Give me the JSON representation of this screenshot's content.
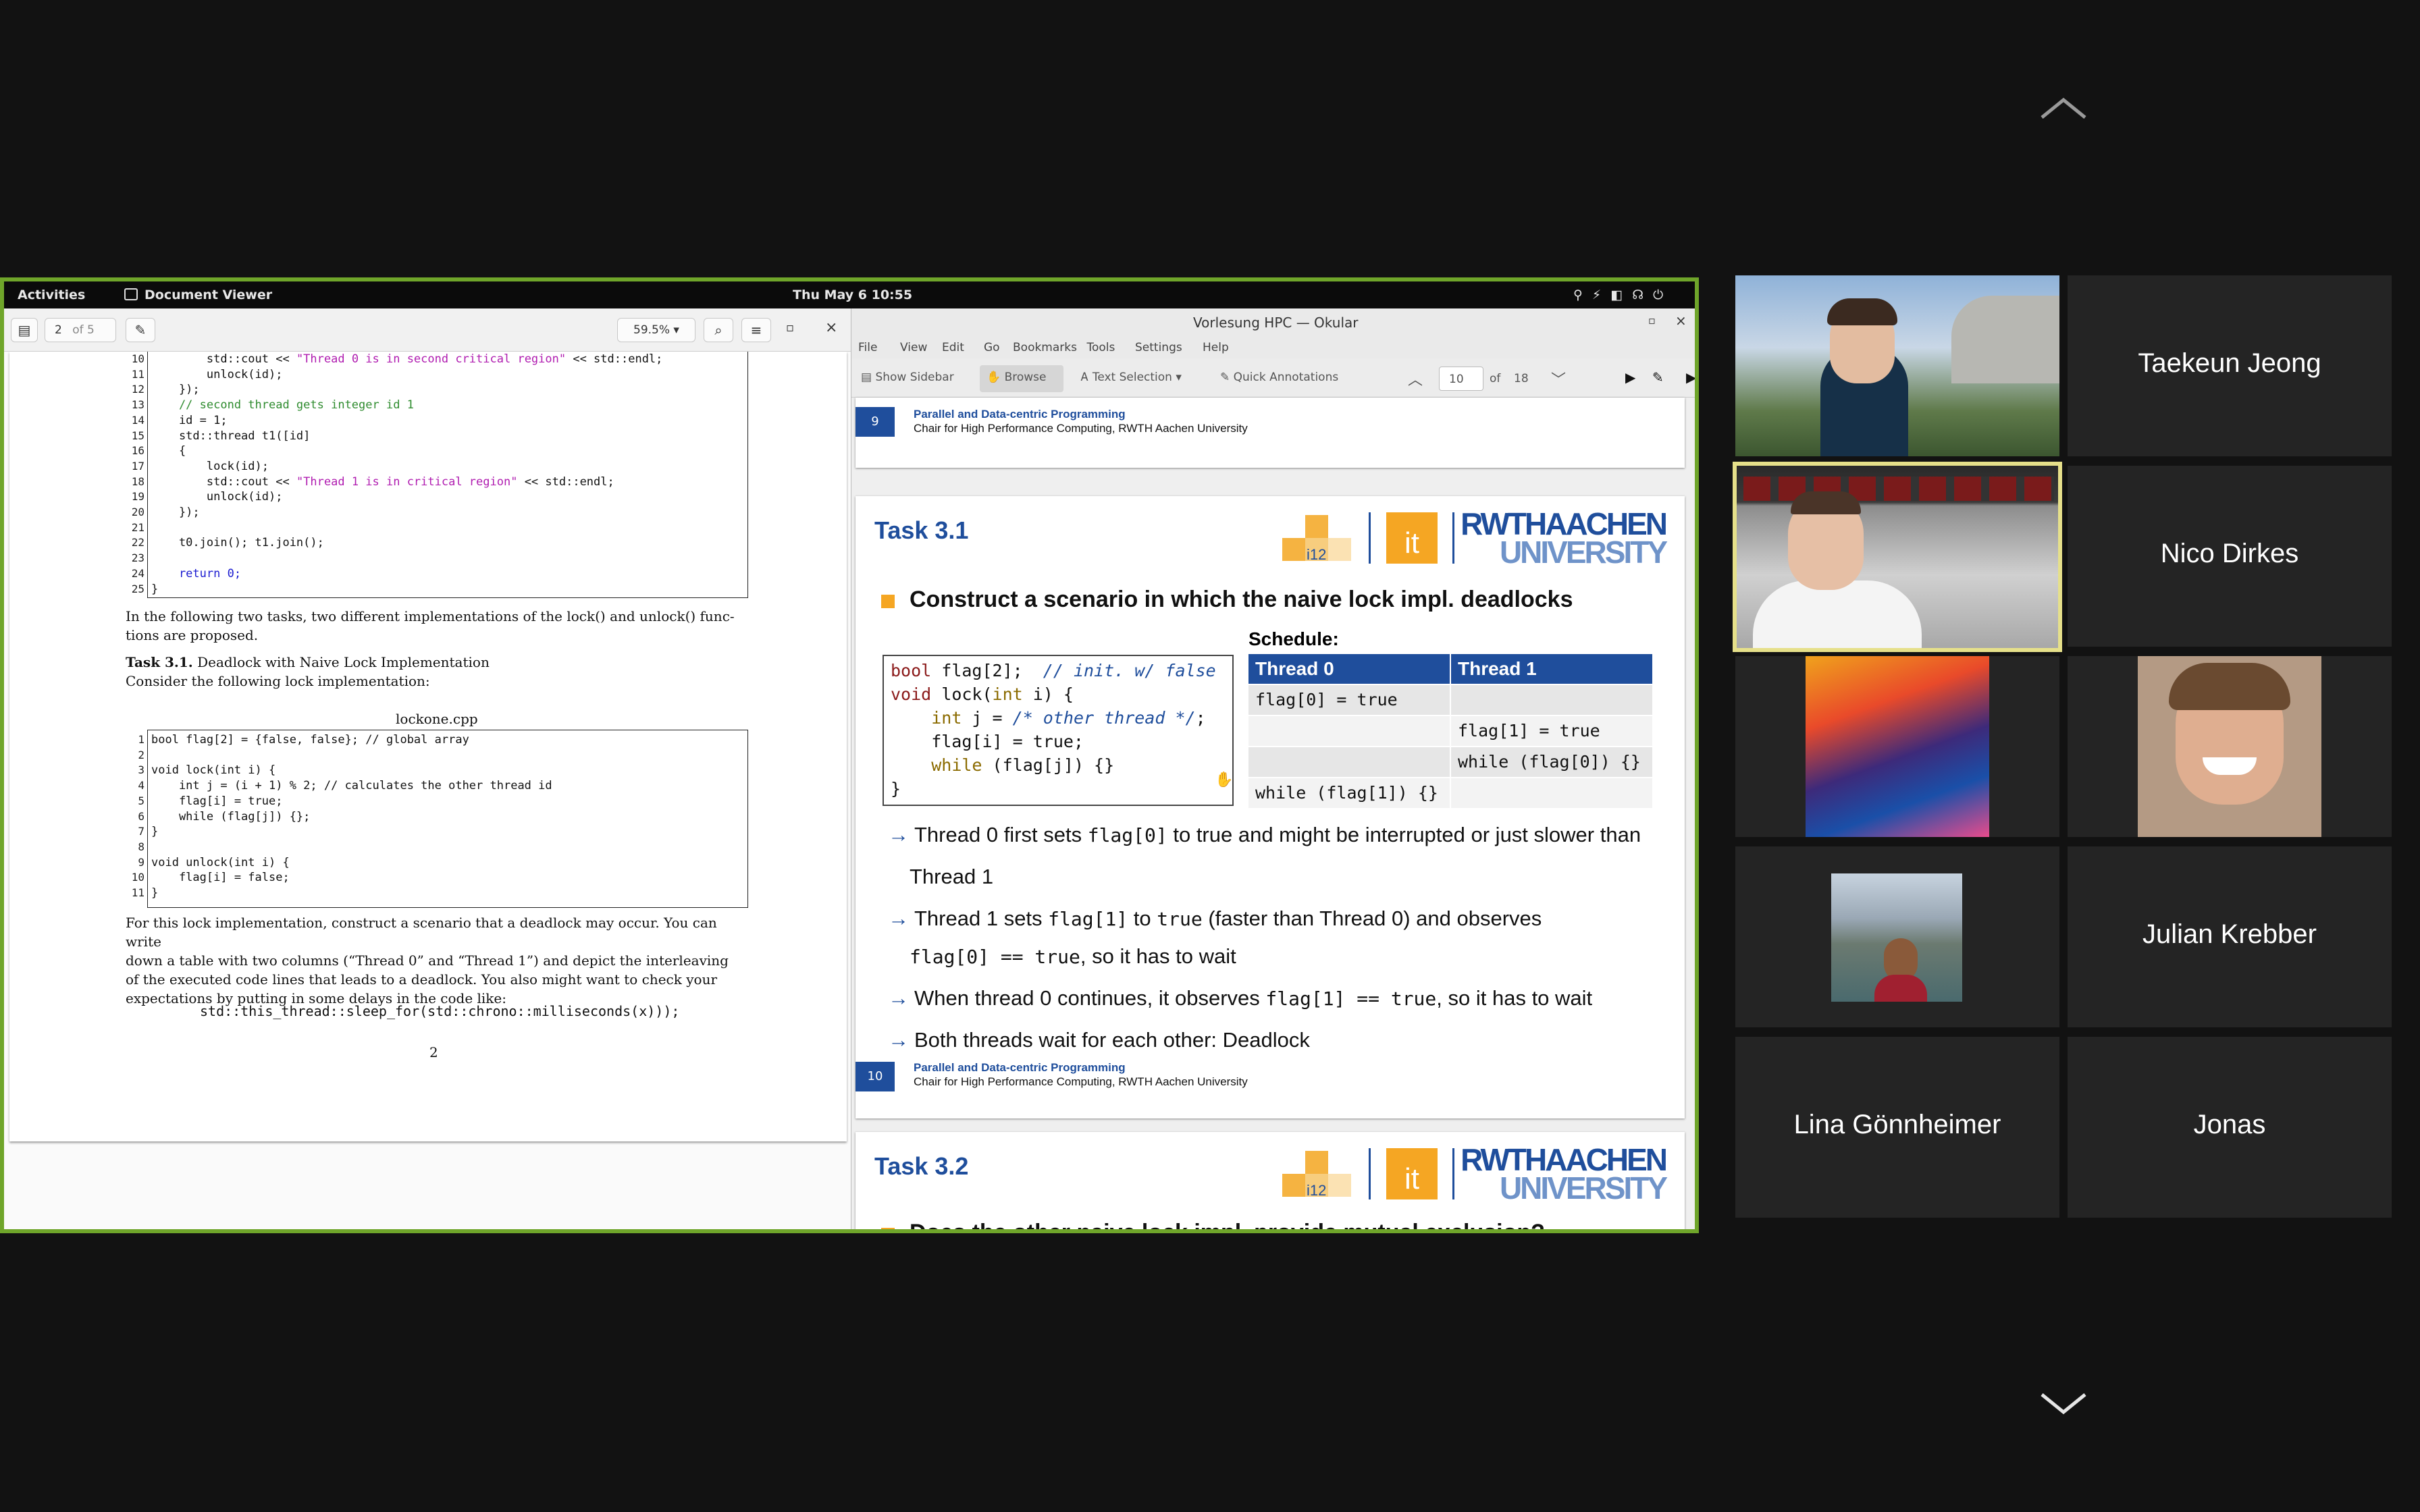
{
  "gnome": {
    "activities": "Activities",
    "app": "Document Viewer",
    "clock": "Thu May 6  10:55"
  },
  "evince": {
    "page_num": "2",
    "page_of": "of 5",
    "zoom": "59.5%",
    "code1": [
      [
        "10",
        "        std::cout << ",
        "\"Thread 0 is in second critical region\"",
        " << std::endl;"
      ],
      [
        "11",
        "        unlock(id);",
        "",
        ""
      ],
      [
        "12",
        "    });",
        "",
        ""
      ],
      [
        "13",
        "",
        "    // second thread gets integer id 1",
        ""
      ],
      [
        "14",
        "    id = 1;",
        "",
        ""
      ],
      [
        "15",
        "    std::thread t1([id]",
        "",
        ""
      ],
      [
        "16",
        "    {",
        "",
        ""
      ],
      [
        "17",
        "        lock(id);",
        "",
        ""
      ],
      [
        "18",
        "        std::cout << ",
        "\"Thread 1 is in critical region\"",
        " << std::endl;"
      ],
      [
        "19",
        "        unlock(id);",
        "",
        ""
      ],
      [
        "20",
        "    });",
        "",
        ""
      ],
      [
        "21",
        "",
        "",
        ""
      ],
      [
        "22",
        "    t0.join(); t1.join();",
        "",
        ""
      ],
      [
        "23",
        "",
        "",
        ""
      ],
      [
        "24",
        "    return 0;",
        "",
        ""
      ],
      [
        "25",
        "}",
        "",
        ""
      ]
    ],
    "para1a": "In the following two tasks, two different implementations of the lock() and unlock() func-",
    "para1b": "tions are proposed.",
    "task_title": "Task 3.1.",
    "task_sub": "Deadlock with Naive Lock Implementation",
    "task_line": "Consider the following lock implementation:",
    "filename": "lockone.cpp",
    "code2": [
      [
        "1",
        "bool flag[2] = {false, false}; // global array"
      ],
      [
        "2",
        ""
      ],
      [
        "3",
        "void lock(int i) {"
      ],
      [
        "4",
        "    int j = (i + 1) % 2; // calculates the other thread id"
      ],
      [
        "5",
        "    flag[i] = true;"
      ],
      [
        "6",
        "    while (flag[j]) {};"
      ],
      [
        "7",
        "}"
      ],
      [
        "8",
        ""
      ],
      [
        "9",
        "void unlock(int i) {"
      ],
      [
        "10",
        "    flag[i] = false;"
      ],
      [
        "11",
        "}"
      ]
    ],
    "para2": [
      "For this lock implementation, construct a scenario that a deadlock may occur. You can write",
      "down a table with two columns (“Thread 0” and “Thread 1”) and depict the interleaving",
      "of the executed code lines that leads to a deadlock. You also might want to check your",
      "expectations by putting in some delays in the code like:"
    ],
    "sleep": "std::this_thread::sleep_for(std::chrono::milliseconds(x)));",
    "page_footer": "2"
  },
  "okular": {
    "title": "Vorlesung HPC  — Okular",
    "menu": [
      "File",
      "View",
      "Edit",
      "Go",
      "Bookmarks",
      "Tools",
      "Settings",
      "Help"
    ],
    "tools": {
      "sidebar": "Show Sidebar",
      "browse": "Browse",
      "text_sel": "Text Selection",
      "annot": "Quick Annotations",
      "page": "10",
      "of": "of",
      "total": "18"
    },
    "footer_l1": "Parallel and Data-centric Programming",
    "footer_l2": "Chair for High Performance Computing, RWTH Aachen University",
    "slide9_num": "9",
    "slide10_num": "10",
    "slide10": {
      "title": "Task 3.1",
      "heading": "Construct a scenario in which the naive lock impl. deadlocks",
      "code": [
        "bool flag[2];  // init. w/ false",
        "void lock(int i) {",
        "    int j = /* other thread */;",
        "    flag[i] = true;",
        "    while (flag[j]) {}",
        "}"
      ],
      "schedule_label": "Schedule:",
      "col0": "Thread 0",
      "col1": "Thread 1",
      "rows": [
        [
          "flag[0] = true",
          ""
        ],
        [
          "",
          "flag[1] = true"
        ],
        [
          "",
          "while (flag[0]) {}"
        ],
        [
          "while (flag[1]) {}",
          ""
        ]
      ],
      "b1a": "Thread 0 first sets ",
      "b1m": "flag[0]",
      "b1b": " to true and might be interrupted or just slower than",
      "b1c": "Thread 1",
      "b2a": "Thread 1 sets ",
      "b2m": "flag[1]",
      "b2b": " to ",
      "b2m2": "true",
      "b2c": " (faster than Thread 0) and observes",
      "b2d": "flag[0] == true",
      ", so it has to wait": "",
      "b2e": ", so it has to wait",
      "b3a": "When thread 0 continues, it observes ",
      "b3m": "flag[1] == true",
      "b3b": ", so it has to wait",
      "b4": "Both threads wait for each other: Deadlock"
    },
    "slide11": {
      "title": "Task 3.2",
      "heading": "Does the other naive lock impl. provide mutual exclusion?"
    },
    "logo_i12": "i12",
    "logo_it": "it",
    "logo_rwth1": "RWTHAACHEN",
    "logo_rwth2": "UNIVERSITY"
  },
  "participants": [
    "Taekeun Jeong",
    "Nico Dirkes",
    "Julian Krebber",
    "Lina Gönnheimer",
    "Jonas"
  ],
  "colors": {
    "share_border": "#6fa52a",
    "rwth_blue": "#1f4e9c",
    "rwth_orange": "#f5a623",
    "speaker_border": "#e6e08a"
  }
}
